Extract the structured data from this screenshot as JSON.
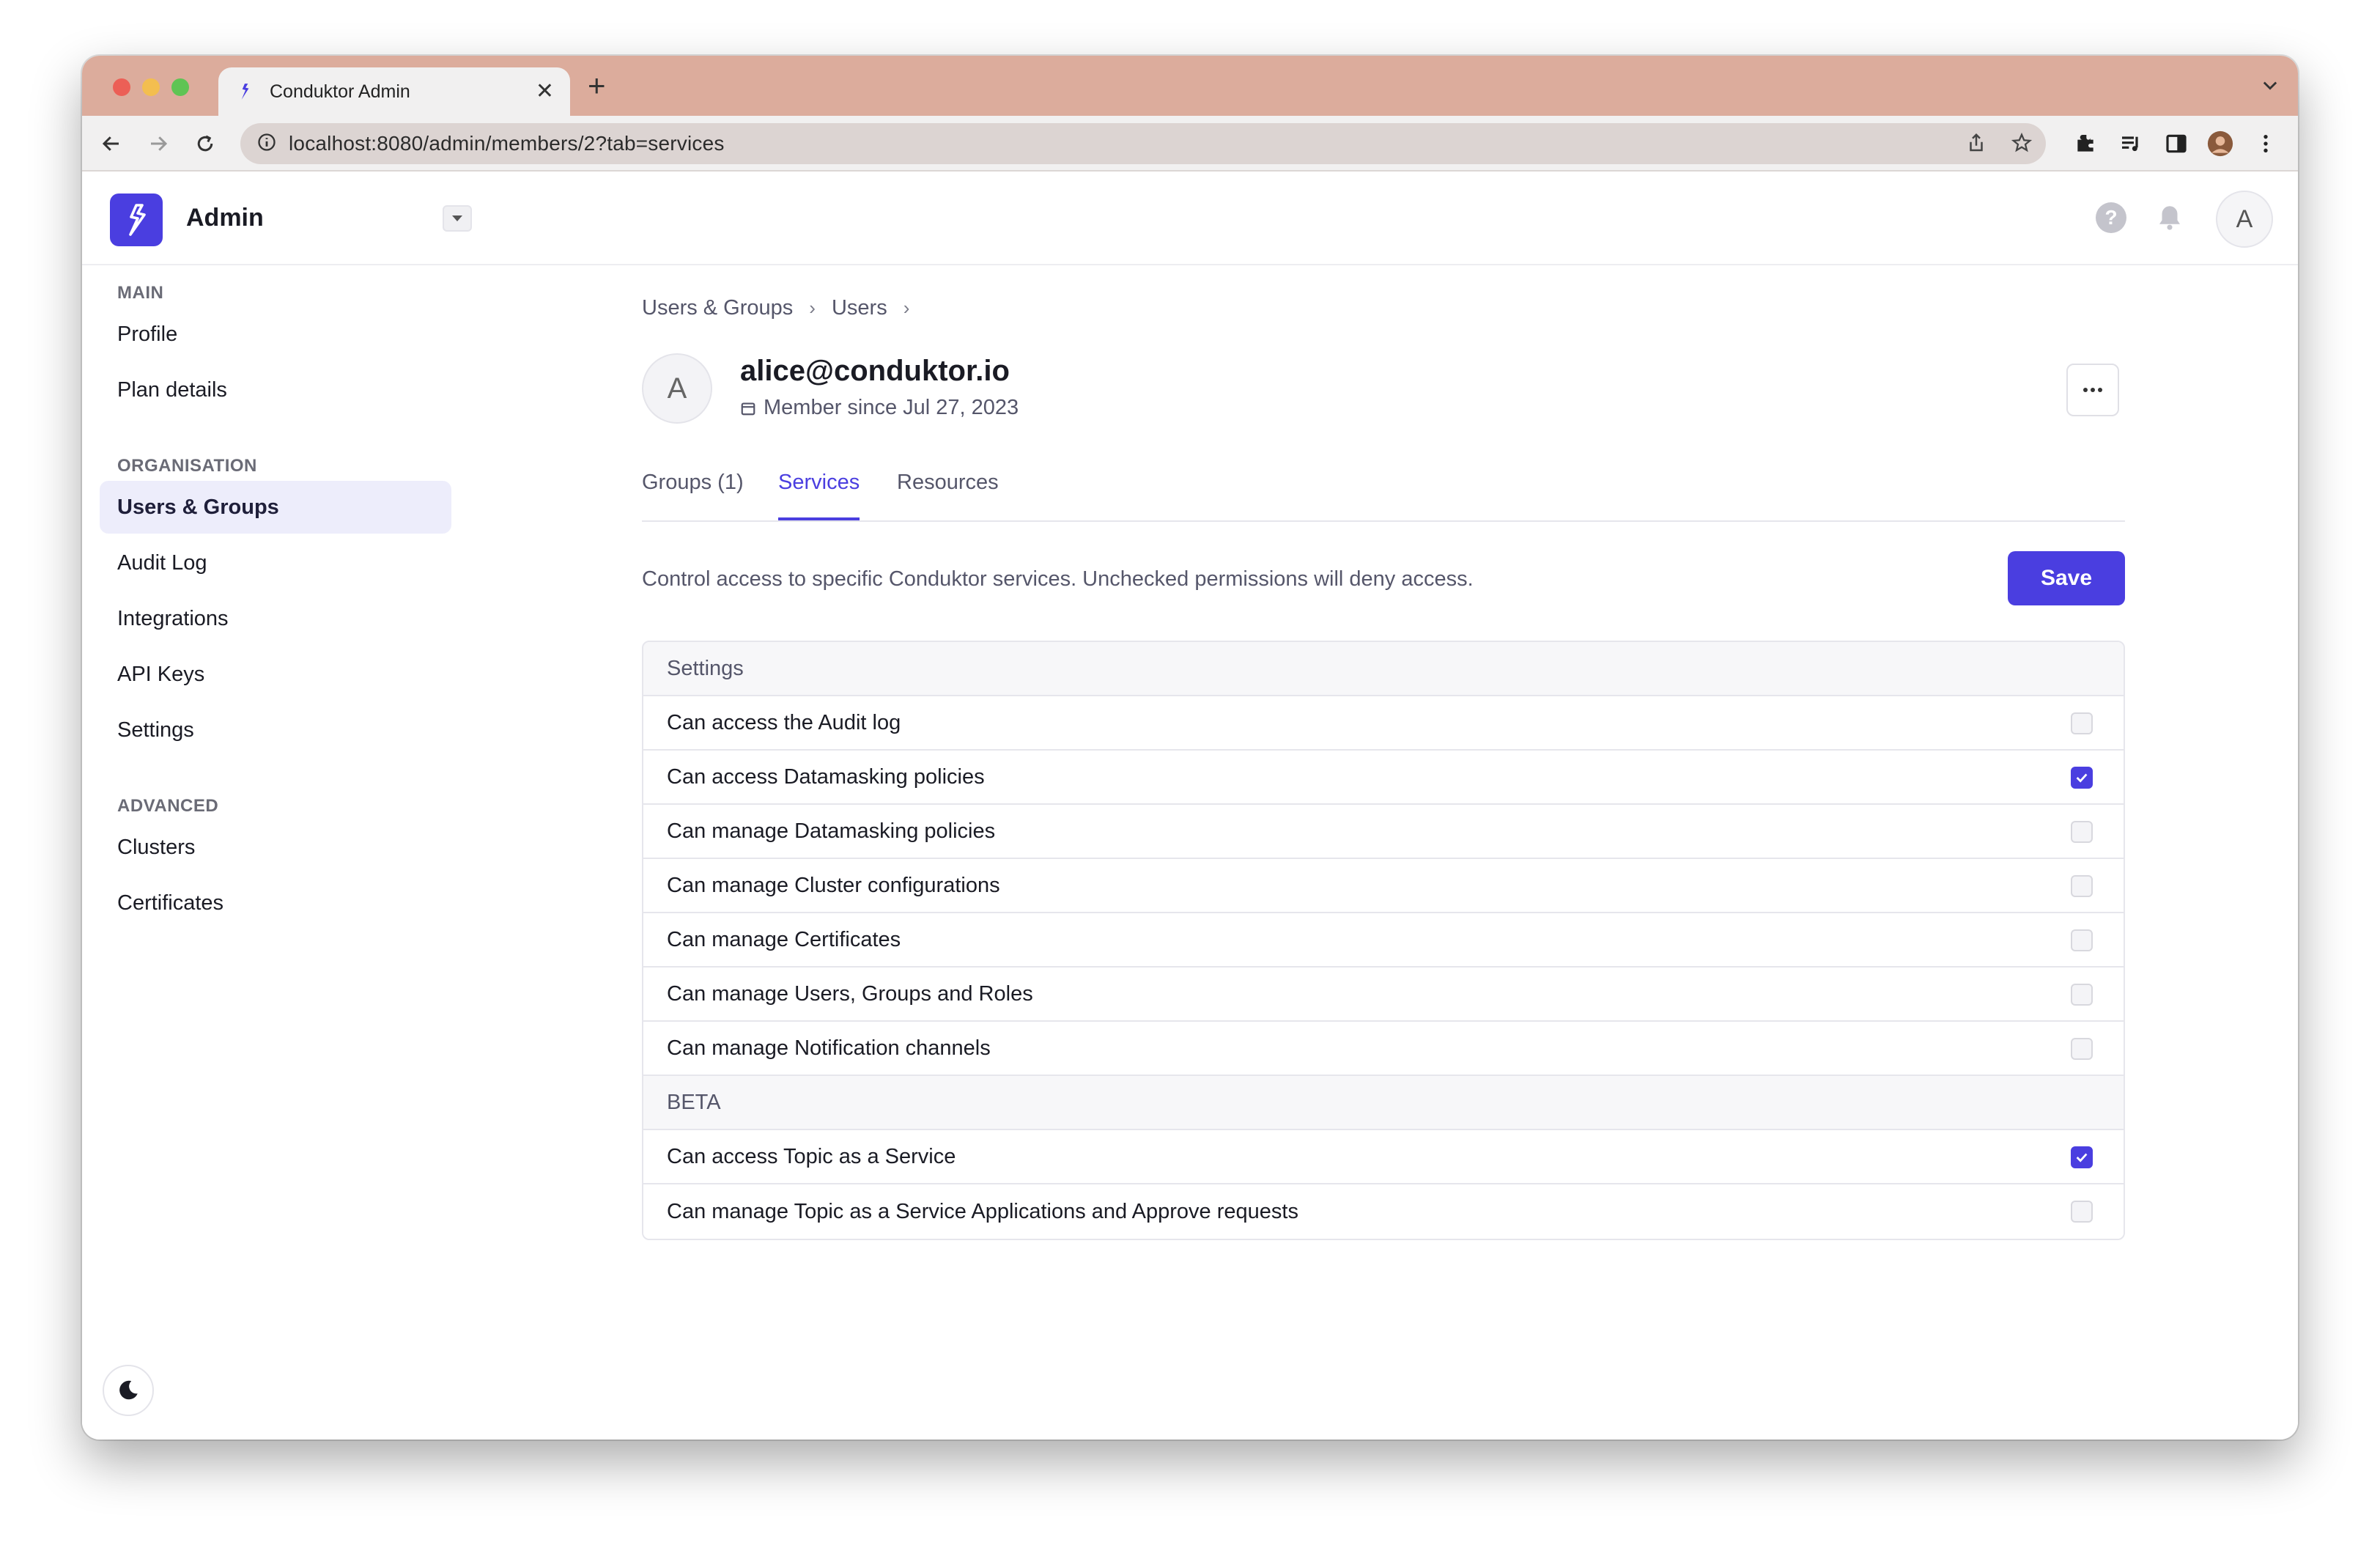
{
  "browser": {
    "tab_title": "Conduktor Admin",
    "url": "localhost:8080/admin/members/2?tab=services"
  },
  "header": {
    "app_name": "Admin",
    "avatar_initial": "A",
    "help_label": "?"
  },
  "sidebar": {
    "sections": [
      {
        "title": "MAIN",
        "items": [
          {
            "label": "Profile"
          },
          {
            "label": "Plan details"
          }
        ]
      },
      {
        "title": "ORGANISATION",
        "items": [
          {
            "label": "Users & Groups",
            "active": true
          },
          {
            "label": "Audit Log"
          },
          {
            "label": "Integrations"
          },
          {
            "label": "API Keys"
          },
          {
            "label": "Settings"
          }
        ]
      },
      {
        "title": "ADVANCED",
        "items": [
          {
            "label": "Clusters"
          },
          {
            "label": "Certificates"
          }
        ]
      }
    ]
  },
  "breadcrumb": [
    "Users & Groups",
    "Users"
  ],
  "user": {
    "initial": "A",
    "email": "alice@conduktor.io",
    "member_since": "Member since Jul 27, 2023"
  },
  "tabs": [
    {
      "label": "Groups (1)",
      "active": false
    },
    {
      "label": "Services",
      "active": true
    },
    {
      "label": "Resources",
      "active": false
    }
  ],
  "description": "Control access to specific Conduktor services. Unchecked permissions will deny access.",
  "save_label": "Save",
  "permission_groups": [
    {
      "title": "Settings",
      "items": [
        {
          "label": "Can access the Audit log",
          "checked": false
        },
        {
          "label": "Can access Datamasking policies",
          "checked": true
        },
        {
          "label": "Can manage Datamasking policies",
          "checked": false
        },
        {
          "label": "Can manage Cluster configurations",
          "checked": false
        },
        {
          "label": "Can manage Certificates",
          "checked": false
        },
        {
          "label": "Can manage Users, Groups and Roles",
          "checked": false
        },
        {
          "label": "Can manage Notification channels",
          "checked": false
        }
      ]
    },
    {
      "title": "BETA",
      "items": [
        {
          "label": "Can access Topic as a Service",
          "checked": true
        },
        {
          "label": "Can manage Topic as a Service Applications and Approve requests",
          "checked": false
        }
      ]
    }
  ],
  "colors": {
    "accent": "#4a3ee0",
    "tabbar": "#dcac9c"
  }
}
